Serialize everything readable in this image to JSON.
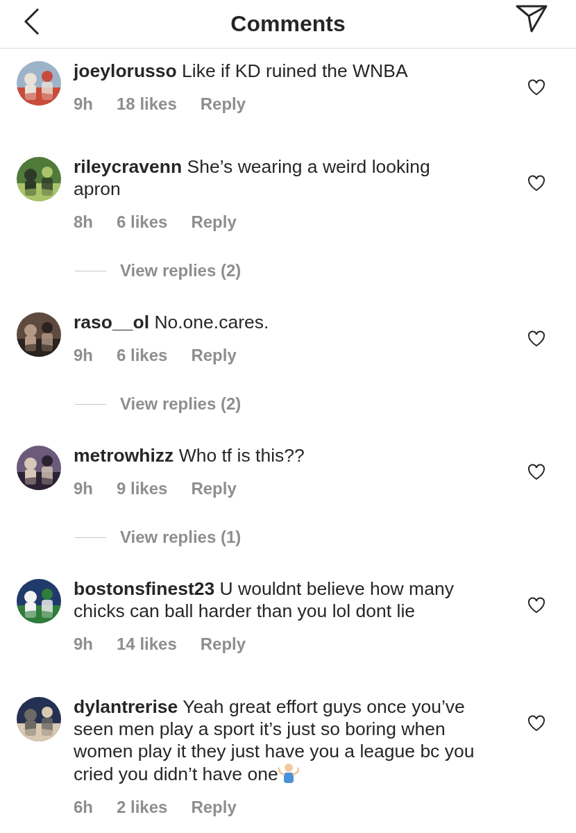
{
  "header": {
    "title": "Comments"
  },
  "comments": [
    {
      "username": "joeylorusso",
      "text": "Like if KD ruined the WNBA",
      "time": "9h",
      "likes": "18 likes",
      "reply": "Reply",
      "kind": "plain"
    },
    {
      "username": "rileycravenn",
      "text": "She’s wearing a weird looking apron",
      "time": "8h",
      "likes": "6 likes",
      "reply": "Reply",
      "view_replies": "View replies (2)",
      "kind": "plain"
    },
    {
      "username": "raso__ol",
      "text": "No.one.cares.",
      "time": "9h",
      "likes": "6 likes",
      "reply": "Reply",
      "view_replies": "View replies (2)",
      "kind": "plain"
    },
    {
      "username": "metrowhizz",
      "text": "Who tf is this??",
      "time": "9h",
      "likes": "9 likes",
      "reply": "Reply",
      "view_replies": "View replies (1)",
      "kind": "plain"
    },
    {
      "username": "bostonsfinest23",
      "text": "U wouldnt believe how many chicks can ball harder than you lol dont lie",
      "time": "9h",
      "likes": "14 likes",
      "reply": "Reply",
      "kind": "plain"
    },
    {
      "username": "dylantrerise",
      "text": "Yeah great effort guys once you’ve seen men play a sport it’s just so boring when women play it they just have you a league bc you cried you didn’t have one",
      "time": "6h",
      "likes": "2 likes",
      "reply": "Reply",
      "kind": "shrug"
    }
  ]
}
